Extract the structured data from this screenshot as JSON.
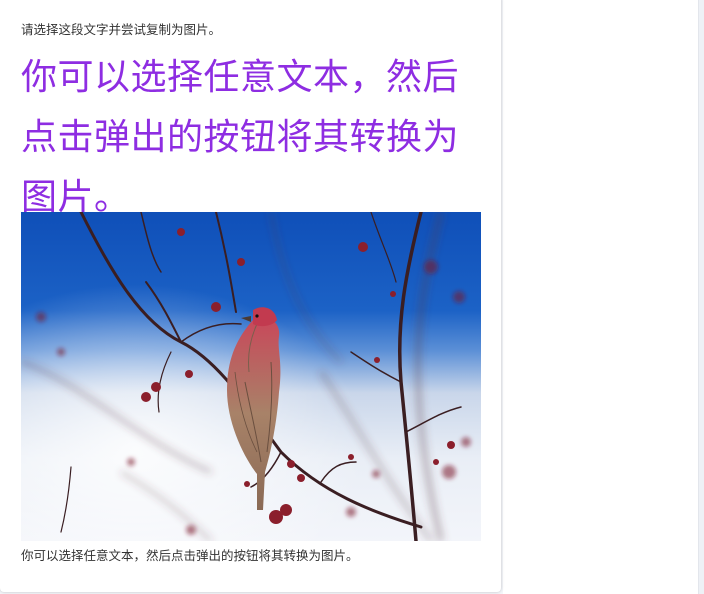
{
  "instruction": "请选择这段文字并尝试复制为图片。",
  "headline": "你可以选择任意文本，然后点击弹出的按钮将其转换为图片。",
  "caption": "你可以选择任意文本，然后点击弹出的按钮将其转换为图片。",
  "photo": {
    "subject": "house finch perched on red berry branches against blue and white sky"
  },
  "colors": {
    "headline": "#8e2de2",
    "body_text": "#333333",
    "sky_blue": "#1d5fc2",
    "berry_red": "#8b1f2c"
  }
}
